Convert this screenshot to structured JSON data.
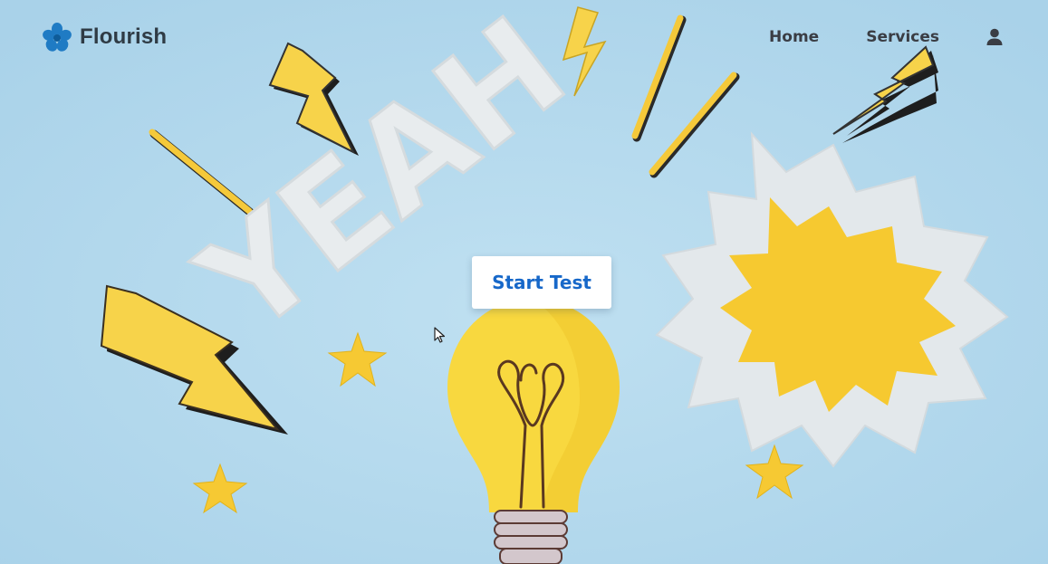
{
  "brand": {
    "name": "Flourish",
    "logo_icon": "flower-icon",
    "logo_color": "#1f7bc4"
  },
  "nav": {
    "items": [
      {
        "label": "Home"
      },
      {
        "label": "Services"
      }
    ],
    "account_icon": "user-icon"
  },
  "hero": {
    "banner_word": "YEAH",
    "cta_label": "Start Test",
    "cta_color": "#1768c9",
    "background_color": "#b4d9ec",
    "accent_color": "#f8cf3f",
    "illustration_icons": [
      "lightning-bolt-icon",
      "lightbulb-icon",
      "star-icon",
      "burst-icon"
    ]
  },
  "pointer_icon": "mouse-pointer-icon"
}
